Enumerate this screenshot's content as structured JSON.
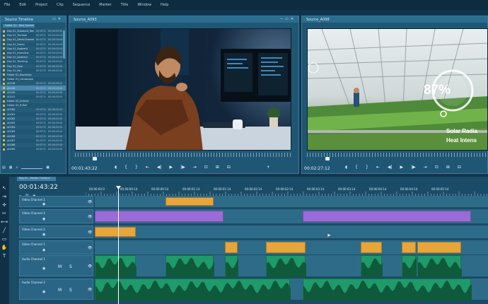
{
  "menu": [
    "File",
    "Edit",
    "Project",
    "Clip",
    "Sequence",
    "Marker",
    "Title",
    "Window",
    "Help"
  ],
  "browser": {
    "title": "Source Timeline",
    "tab": "Folder 01 - Raw Scenes",
    "items": [
      [
        "Day 01_Shootout_Rack",
        "00:07:54",
        "00:00:00:00"
      ],
      [
        "Day 01_Trimbak",
        "00:07:54",
        "00:00:00:00"
      ],
      [
        "Day 01_Detail Framework",
        "00:07:54",
        "00:00:00:00"
      ],
      [
        "Day 01_Detail",
        "00:07:54",
        "00:00:00:00"
      ],
      [
        "Day 01_Ambient",
        "00:07:54",
        "00:00:00:00"
      ],
      [
        "Day 01_Interview",
        "00:07:54",
        "00:00:00:00"
      ],
      [
        "Day 01_Ambient",
        "00:07:54",
        "00:00:00:00"
      ],
      [
        "Day 01_Tracking",
        "00:07:54",
        "00:00:00:00"
      ],
      [
        "Day 01_Final",
        "00:07:54",
        "00:00:00:00"
      ],
      [
        "Day 01_Pan",
        "00:07:54",
        "00:00:00:00"
      ],
      [
        "Folder 01_Backdrop",
        "",
        ""
      ],
      [
        "Folder 01_Landscape",
        "",
        ""
      ],
      [
        "A0238",
        "00:07:54",
        "00:00:00:00"
      ],
      [
        "A0239",
        "00:07:54",
        "00:00:00:00"
      ],
      [
        "A0240",
        "00:07:54",
        "00:00:00:00"
      ],
      [
        "A0241",
        "00:07:54",
        "00:00:00:00"
      ],
      [
        "Folder 02_Interior",
        "",
        ""
      ],
      [
        "Folder 03_B-Roll",
        "",
        ""
      ],
      [
        "A0260",
        "00:07:54",
        "00:00:00:00"
      ],
      [
        "A0261",
        "00:07:54",
        "00:00:00:00"
      ],
      [
        "A0262",
        "00:07:54",
        "00:00:00:00"
      ],
      [
        "A0263",
        "00:07:54",
        "00:00:00:00"
      ],
      [
        "A0264",
        "00:07:54",
        "00:00:00:00"
      ],
      [
        "A0265",
        "00:07:54",
        "00:00:00:00"
      ],
      [
        "A0266",
        "00:07:54",
        "00:00:00:00"
      ],
      [
        "A0267",
        "00:07:54",
        "00:00:00:00"
      ],
      [
        "A0268",
        "00:07:54",
        "00:00:00:00"
      ],
      [
        "A0269",
        "00:07:54",
        "00:00:00:00"
      ]
    ]
  },
  "viewer1": {
    "title": "Source_A093",
    "timecode": "00:01:43:22"
  },
  "viewer2": {
    "title": "Source_A098",
    "timecode": "00:02:27:12",
    "overlay_percent": "87%",
    "overlay_label1": "Solar Radia",
    "overlay_label2": "Heat Intens"
  },
  "timeline": {
    "tab": "Seq 01 - Master Timeline",
    "timecode": "00:01:43:22",
    "ruler": [
      "00:00:00:0",
      "00:00:00:14",
      "00:00:00:14",
      "00:00:01:14",
      "00:00:01:14",
      "00:00:02:14",
      "00:00:02:14",
      "00:00:03:14",
      "00:00:03:14",
      "00:00:04:14",
      "00:00:04:14",
      "00:00:05:14"
    ],
    "tracks": [
      {
        "name": "Video Channel 1",
        "type": "video"
      },
      {
        "name": "Video Channel 3",
        "type": "video"
      },
      {
        "name": "Video Channel 2",
        "type": "video"
      },
      {
        "name": "Video Channel 1",
        "type": "video"
      },
      {
        "name": "Audio Channel 1",
        "type": "audio",
        "m": "M",
        "s": "S"
      },
      {
        "name": "Audio Channel 2",
        "type": "audio",
        "m": "M",
        "s": "S"
      }
    ]
  },
  "colors": {
    "orange": "#e8a53a",
    "purple": "#9b6bd8",
    "green": "#1f9a6a",
    "bg": "#1f5673"
  }
}
